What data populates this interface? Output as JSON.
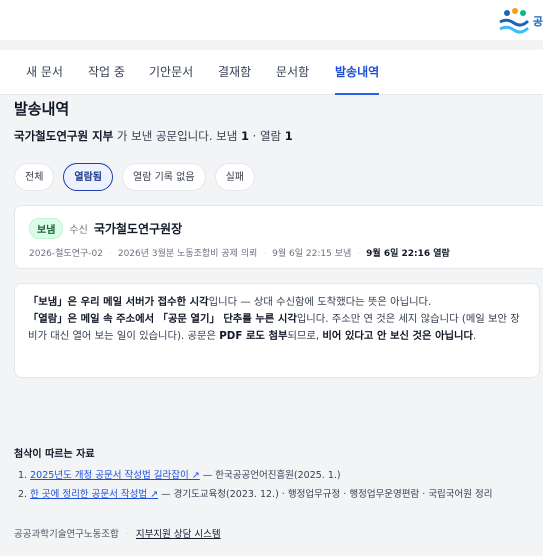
{
  "logo": {
    "text": "공"
  },
  "tabs": [
    {
      "label": "새 문서"
    },
    {
      "label": "작업 중"
    },
    {
      "label": "기안문서"
    },
    {
      "label": "결재함"
    },
    {
      "label": "문서함"
    },
    {
      "label": "발송내역",
      "active": true
    }
  ],
  "page": {
    "title": "발송내역",
    "subtitle": {
      "sender": "국가철도연구원 지부",
      "mid": " 가 보낸 공문입니다. 보냄 ",
      "sent_count": "1",
      "dot": " · 열람 ",
      "read_count": "1"
    }
  },
  "filters": [
    {
      "label": "전체"
    },
    {
      "label": "열람됨",
      "active": true
    },
    {
      "label": "열람 기록 없음"
    },
    {
      "label": "실패"
    }
  ],
  "item": {
    "badge": "보냄",
    "recv_label": "수신",
    "recipient": "국가철도연구원장",
    "doc_no": "2026-철도연구-02",
    "doc_title": "2026년 3월분 노동조합비 공제 의뢰",
    "sent_at": "9월 6일 22:15 보냄",
    "read_at": "9월 6일 22:16 열람"
  },
  "note": {
    "p1_b": "「보냄」은 우리 메일 서버가 접수한 시각",
    "p1": "입니다 — 상대 수신함에 도착했다는 뜻은 아닙니다.",
    "p2_b1": "「열람」은 메일 속 주소에서 「공문 열기」 단추를 누른 시각",
    "p2_a": "입니다. 주소만 연 것은 세지 않습니다 (메일 보안 장비가 대신 열어 보는 일이 있습니다). 공문은 ",
    "p2_b2": "PDF 로도 첨부",
    "p2_c": "되므로, ",
    "p2_b3": "비어 있다고 안 보신 것은 아닙니다",
    "p2_d": "."
  },
  "refs": {
    "title": "첨삭이 따르는 자료",
    "items": [
      {
        "num": "1.",
        "link": "2025년도 개정 공문서 작성법 길라잡이 ↗",
        "rest": " — 한국공공언어진흥원(2025. 1.)"
      },
      {
        "num": "2.",
        "link": "한 곳에 정리한 공문서 작성법 ↗",
        "rest": " — 경기도교육청(2023. 12.) · 행정업무규정 · 행정업무운영편람 · 국립국어원 정리"
      }
    ]
  },
  "footer": {
    "org": "공공과학기술연구노동조합",
    "link": "지부지원 상담 시스템"
  },
  "colors": {
    "accent": "#2563eb",
    "badge_bg": "#dcfce7",
    "background": "#f3f4f6"
  }
}
